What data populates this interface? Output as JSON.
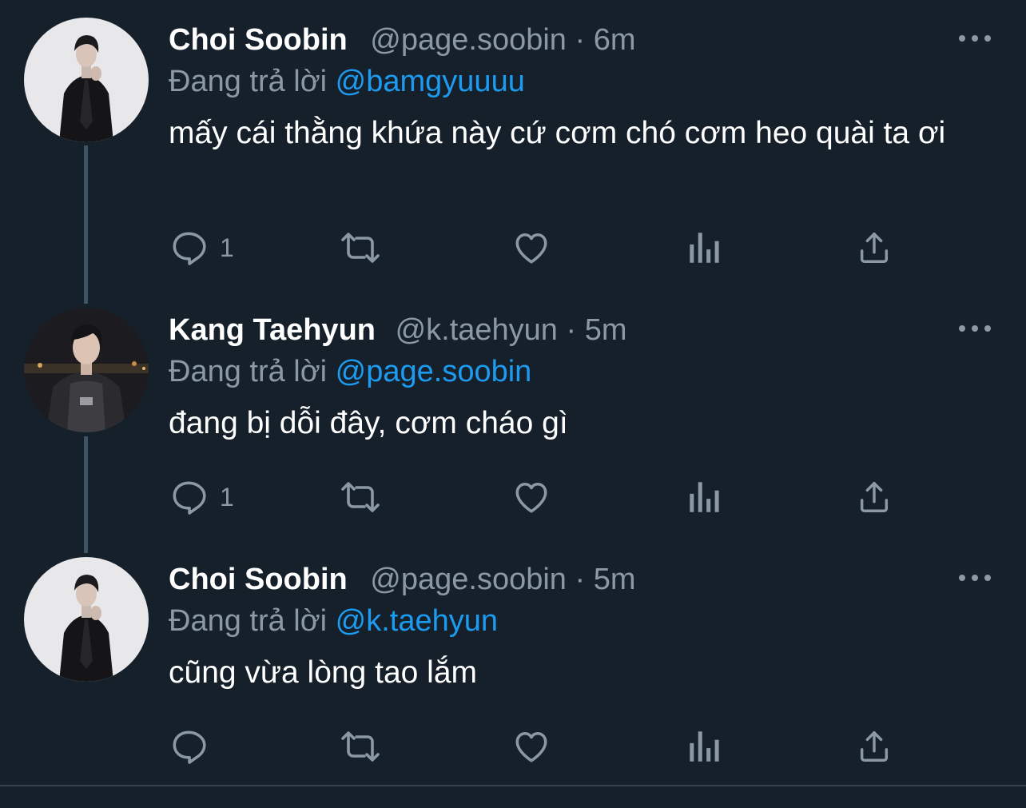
{
  "colors": {
    "background": "#15202b",
    "text_primary": "#ffffff",
    "text_secondary": "#8b98a5",
    "mention": "#1d9bf0",
    "thread_line": "#3d5466"
  },
  "tweets": [
    {
      "name": "Choi Soobin",
      "handle": "@page.soobin",
      "separator": "·",
      "time": "6m",
      "reply_prefix": "Đang trả lời",
      "reply_to": "@bamgyuuuu",
      "text": "mấy cái thằng khứa này cứ cơm chó cơm heo quài ta ơi",
      "reply_count": "1",
      "icons": [
        "reply-icon",
        "retweet-icon",
        "like-icon",
        "analytics-icon",
        "share-icon",
        "more-icon"
      ]
    },
    {
      "name": "Kang Taehyun",
      "handle": "@k.taehyun",
      "separator": "·",
      "time": "5m",
      "reply_prefix": "Đang trả lời",
      "reply_to": "@page.soobin",
      "text": "đang bị dỗi đây, cơm cháo gì",
      "reply_count": "1",
      "icons": [
        "reply-icon",
        "retweet-icon",
        "like-icon",
        "analytics-icon",
        "share-icon",
        "more-icon"
      ]
    },
    {
      "name": "Choi Soobin",
      "handle": "@page.soobin",
      "separator": "·",
      "time": "5m",
      "reply_prefix": "Đang trả lời",
      "reply_to": "@k.taehyun",
      "text": "cũng vừa lòng tao lắm",
      "reply_count": "",
      "icons": [
        "reply-icon",
        "retweet-icon",
        "like-icon",
        "analytics-icon",
        "share-icon",
        "more-icon"
      ]
    }
  ]
}
